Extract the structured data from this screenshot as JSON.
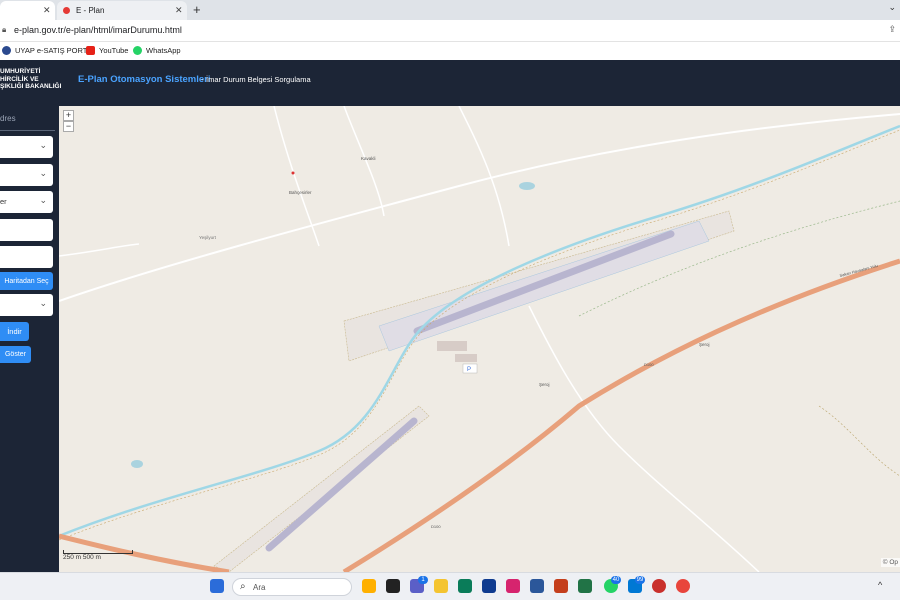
{
  "browser": {
    "tabs": [
      {
        "label": ""
      },
      {
        "label": "E - Plan"
      }
    ],
    "url": "e-plan.gov.tr/e-plan/html/imarDurumu.html",
    "bookmarks": [
      "UYAP e-SATIŞ PORT...",
      "YouTube",
      "WhatsApp"
    ]
  },
  "header": {
    "ministry_lines": [
      "UMHURİYETİ",
      "HİRCİLİK VE",
      "ŞIKLIĞI BAKANLIĞI"
    ],
    "title": "E-Plan Otomasyon Sistemleri",
    "separator": "-",
    "subtitle": "İmar Durum Belgesi Sorgulama"
  },
  "sidebar": {
    "label": "dres",
    "selects": [
      {
        "text": ""
      },
      {
        "text": ""
      },
      {
        "text": "er"
      }
    ],
    "inputs": [
      "",
      ""
    ],
    "map_select_button": "Haritadan Seç",
    "select4": "",
    "download_button": "İndir",
    "show_button": "Göster"
  },
  "map": {
    "zoom_in": "+",
    "zoom_out": "−",
    "scale_label": "250 m   500 m",
    "attribution": "© Op",
    "place_labels": [
      "Kavakli",
      "Bahçesirler",
      "Yeşilyurt",
      "Şeroj",
      "Şeroj"
    ],
    "road_labels": [
      "D100",
      "D100",
      "Sakarı Havaalanı Yolu"
    ]
  },
  "taskbar": {
    "search_placeholder": "Ara",
    "badges": [
      "1",
      "40",
      "99"
    ]
  }
}
